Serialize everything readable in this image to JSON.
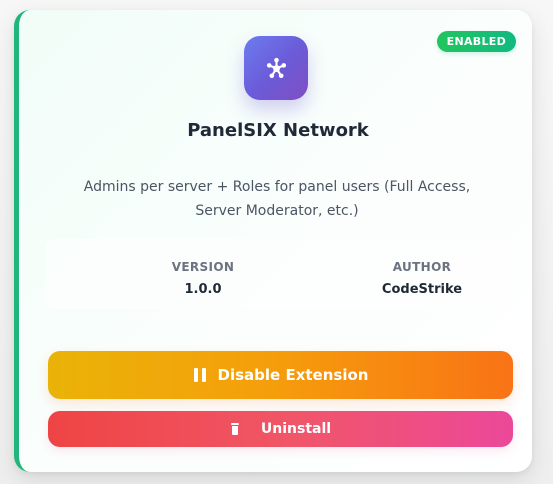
{
  "extension": {
    "status": "ENABLED",
    "name": "PanelSIX Network",
    "description": "Admins per server + Roles for panel users (Full Access, Server Moderator, etc.)",
    "icon": "network-hub-icon",
    "meta": {
      "version_label": "VERSION",
      "version_value": "1.0.0",
      "author_label": "AUTHOR",
      "author_value": "CodeStrike"
    }
  },
  "actions": {
    "disable_label": "Disable Extension",
    "disable_icon": "pause-icon",
    "uninstall_label": "Uninstall",
    "uninstall_icon": "trash-icon"
  },
  "colors": {
    "accent_border": "#20b57a",
    "status_enabled": "#10b981",
    "icon_gradient_start": "#6d7cf0",
    "icon_gradient_end": "#7f4ec4",
    "disable_gradient_start": "#eab308",
    "disable_gradient_end": "#f97316",
    "uninstall_gradient_start": "#ef4444",
    "uninstall_gradient_end": "#ec4899",
    "title_text": "#1f2937",
    "muted_text": "#6b7280"
  }
}
